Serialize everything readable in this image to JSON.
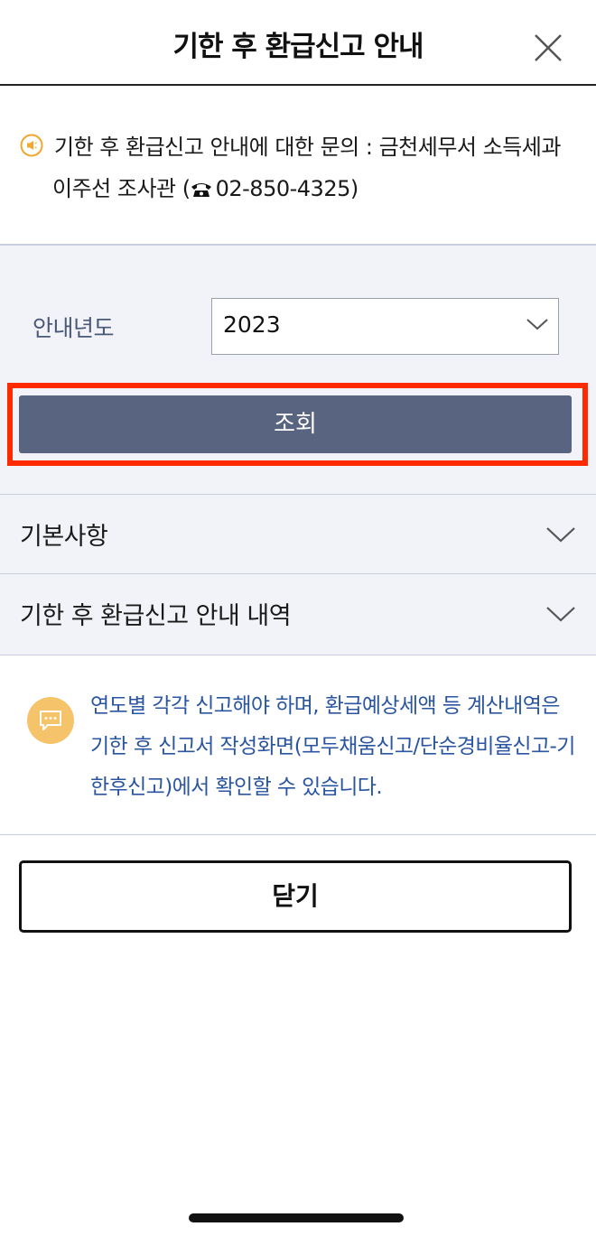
{
  "header": {
    "title": "기한 후 환급신고 안내"
  },
  "inquiry": {
    "text_prefix": "기한 후 환급신고 안내에 대한 문의 : 금천세무서 소득세과 이주선 조사관 (",
    "phone": "02-850-4325)"
  },
  "form": {
    "year_label": "안내년도",
    "year_value": "2023",
    "search_label": "조회"
  },
  "accordion": [
    {
      "label": "기본사항"
    },
    {
      "label": "기한 후 환급신고 안내 내역"
    }
  ],
  "notice": {
    "text": "연도별 각각 신고해야 하며, 환급예상세액 등 계산내역은 기한 후 신고서 작성화면(모두채움신고/단순경비율신고-기한후신고)에서 확인할 수 있습니다."
  },
  "footer": {
    "close_label": "닫기"
  },
  "colors": {
    "primary_button": "#596580",
    "highlight": "#ff2a00",
    "notice_text": "#2a55a0",
    "notice_icon": "#f5c46a",
    "panel_bg": "#f2f3f8"
  }
}
